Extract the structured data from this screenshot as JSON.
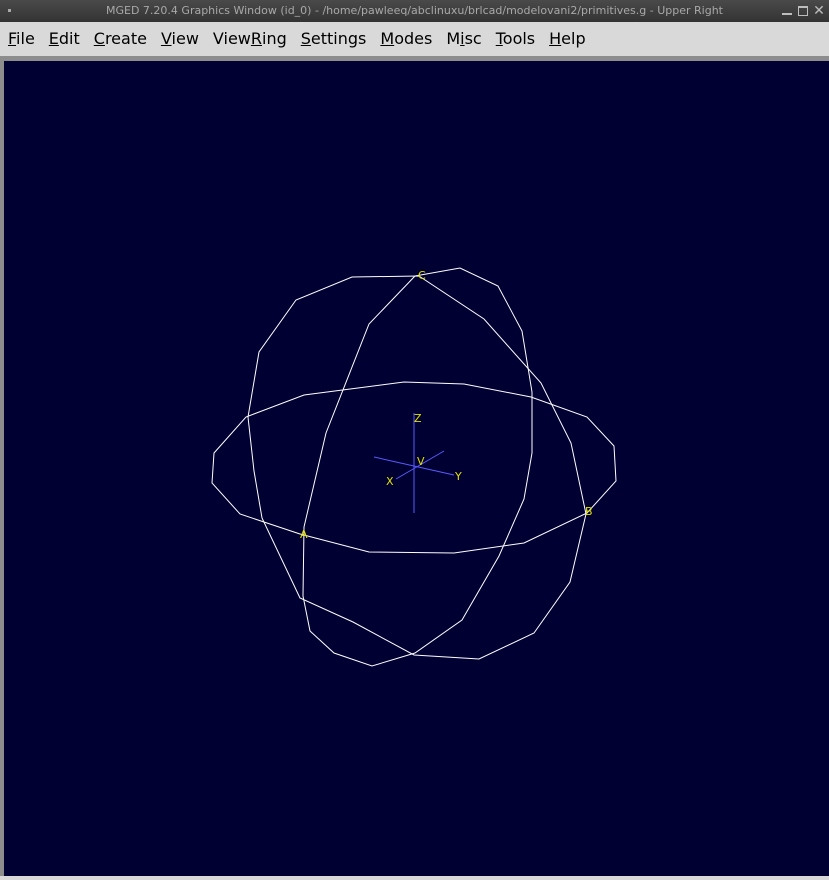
{
  "window": {
    "title": "MGED 7.20.4 Graphics Window (id_0) - /home/pawleeq/abclinuxu/brlcad/modelovani2/primitives.g - Upper Right",
    "close_glyph": "✕"
  },
  "menubar": {
    "items": [
      {
        "key": "file",
        "pre": "",
        "ul": "F",
        "post": "ile"
      },
      {
        "key": "edit",
        "pre": "",
        "ul": "E",
        "post": "dit"
      },
      {
        "key": "create",
        "pre": "",
        "ul": "C",
        "post": "reate"
      },
      {
        "key": "view",
        "pre": "",
        "ul": "V",
        "post": "iew"
      },
      {
        "key": "viewring",
        "pre": "View",
        "ul": "R",
        "post": "ing"
      },
      {
        "key": "settings",
        "pre": "",
        "ul": "S",
        "post": "ettings"
      },
      {
        "key": "modes",
        "pre": "",
        "ul": "M",
        "post": "odes"
      },
      {
        "key": "misc",
        "pre": "M",
        "ul": "i",
        "post": "sc"
      },
      {
        "key": "tools",
        "pre": "",
        "ul": "T",
        "post": "ools"
      },
      {
        "key": "help",
        "pre": "",
        "ul": "H",
        "post": "elp"
      }
    ]
  },
  "viewport": {
    "background": "#000033",
    "wireframe_color": "#ffffff",
    "label_color": "#e0e000",
    "axes_color": "#5a5aff",
    "vertex_labels": {
      "a": "A",
      "b": "B",
      "c": "C",
      "v": "V"
    },
    "axis_labels": {
      "x": "X",
      "y": "Y",
      "z": "Z"
    }
  }
}
